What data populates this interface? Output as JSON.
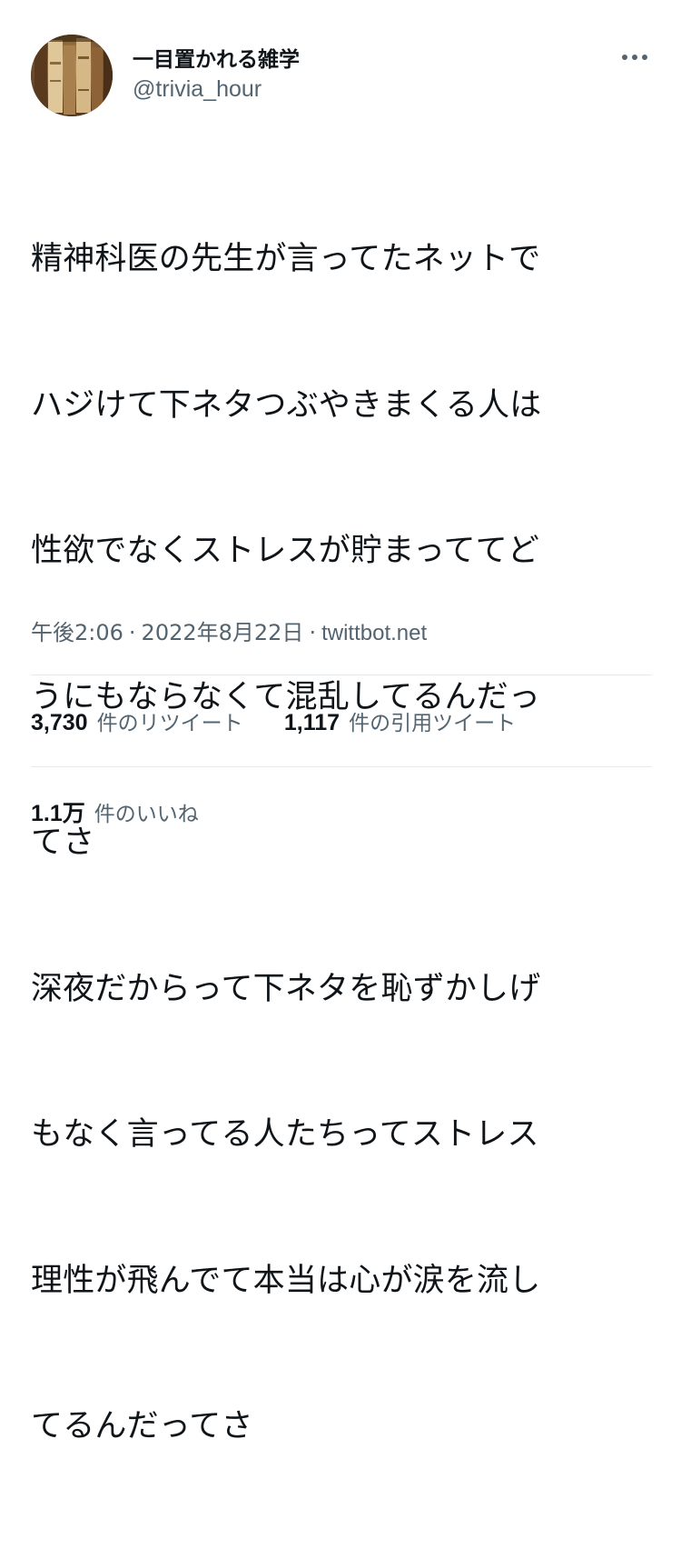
{
  "account": {
    "display_name": "一目置かれる雑学",
    "handle": "@trivia_hour",
    "avatar_icon": "bookshelf-avatar"
  },
  "more_icon": "more-horizontal-icon",
  "tweet": {
    "lines": [
      "精神科医の先生が言ってたネットで",
      "ハジけて下ネタつぶやきまくる人は",
      "性欲でなくストレスが貯まっててど",
      "うにもならなくて混乱してるんだっ",
      "てさ",
      "深夜だからって下ネタを恥ずかしげ",
      "もなく言ってる人たちってストレス",
      "理性が飛んでて本当は心が涙を流し",
      "てるんだってさ"
    ]
  },
  "meta": {
    "time": "午後2:06",
    "separator": "·",
    "date": "2022年8月22日",
    "source": "twittbot.net"
  },
  "stats": {
    "retweets": {
      "count": "3,730",
      "label": "件のリツイート"
    },
    "quotes": {
      "count": "1,117",
      "label": "件の引用ツイート"
    },
    "likes": {
      "count": "1.1万",
      "label": "件のいいね"
    }
  },
  "colors": {
    "text_primary": "#0f1419",
    "text_secondary": "#536471",
    "divider": "#e6e9eb"
  }
}
